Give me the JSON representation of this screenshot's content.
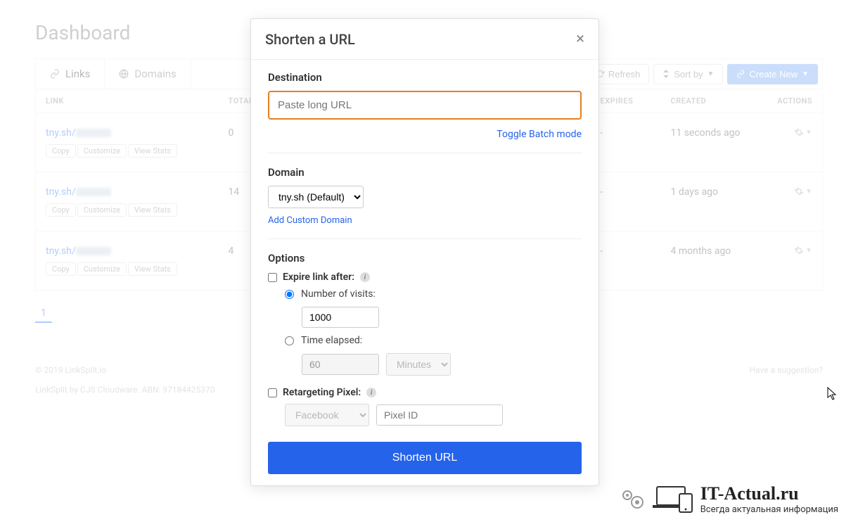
{
  "page": {
    "title": "Dashboard"
  },
  "tabs": {
    "links": "Links",
    "domains": "Domains"
  },
  "toolbar": {
    "refresh": "Refresh",
    "sort": "Sort by",
    "create": "Create New"
  },
  "columns": {
    "link": "LINK",
    "total": "TOTAL",
    "expires": "EXPIRES",
    "created": "CREATED",
    "actions": "ACTIONS"
  },
  "rows": [
    {
      "prefix": "tny.sh/",
      "total": "0",
      "expires": "-",
      "created": "11 seconds ago"
    },
    {
      "prefix": "tny.sh/",
      "total": "14",
      "expires": "-",
      "created": "1 days ago"
    },
    {
      "prefix": "tny.sh/",
      "total": "4",
      "expires": "-",
      "created": "4 months ago"
    }
  ],
  "rowButtons": {
    "copy": "Copy",
    "customize": "Customize",
    "stats": "View Stats"
  },
  "pagination": {
    "page1": "1"
  },
  "footer": {
    "copyright": "© 2019 LinkSplit.io",
    "company": "LinkSplit by CJS Cloudware. ABN: 97184425370",
    "suggestion": "Have a suggestion?"
  },
  "modal": {
    "title": "Shorten a URL",
    "destination": {
      "label": "Destination",
      "placeholder": "Paste long URL",
      "toggle": "Toggle Batch mode"
    },
    "domain": {
      "label": "Domain",
      "selected": "tny.sh (Default)",
      "add": "Add Custom Domain"
    },
    "options": {
      "label": "Options",
      "expire": "Expire link after:",
      "visits": "Number of visits:",
      "visitsValue": "1000",
      "time": "Time elapsed:",
      "timeValue": "60",
      "timeUnit": "Minutes",
      "retarget": "Retargeting Pixel:",
      "pixelSource": "Facebook",
      "pixelPlaceholder": "Pixel ID"
    },
    "submit": "Shorten URL"
  },
  "watermark": {
    "title": "IT-Actual.ru",
    "sub": "Всегда актуальная информация"
  }
}
